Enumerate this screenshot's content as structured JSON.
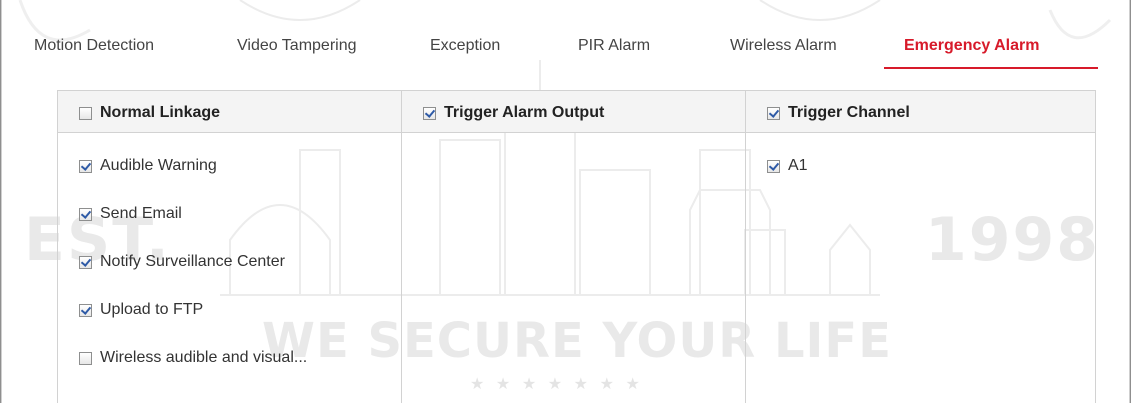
{
  "watermark": {
    "left_text": "EST.",
    "right_text": "1998",
    "slogan": "WE SECURE YOUR LIFE",
    "stars": "★ ★ ★ ★ ★ ★ ★"
  },
  "tabs": [
    {
      "label": "Motion Detection",
      "active": false
    },
    {
      "label": "Video Tampering",
      "active": false
    },
    {
      "label": "Exception",
      "active": false
    },
    {
      "label": "PIR Alarm",
      "active": false
    },
    {
      "label": "Wireless Alarm",
      "active": false
    },
    {
      "label": "Emergency Alarm",
      "active": true
    }
  ],
  "columns": {
    "normal_linkage": {
      "header": {
        "label": "Normal Linkage",
        "checked": false
      },
      "items": [
        {
          "label": "Audible Warning",
          "checked": true
        },
        {
          "label": "Send Email",
          "checked": true
        },
        {
          "label": "Notify Surveillance Center",
          "checked": true
        },
        {
          "label": "Upload to FTP",
          "checked": true
        },
        {
          "label": "Wireless audible and visual...",
          "checked": false
        }
      ]
    },
    "trigger_alarm_output": {
      "header": {
        "label": "Trigger Alarm Output",
        "checked": true
      },
      "items": []
    },
    "trigger_channel": {
      "header": {
        "label": "Trigger Channel",
        "checked": true
      },
      "items": [
        {
          "label": "A1",
          "checked": true
        }
      ]
    }
  },
  "colors": {
    "accent": "#d71a2a",
    "checkmark": "#2e5aa6",
    "border": "#d2d2d2",
    "header_bg": "#f4f4f4"
  }
}
